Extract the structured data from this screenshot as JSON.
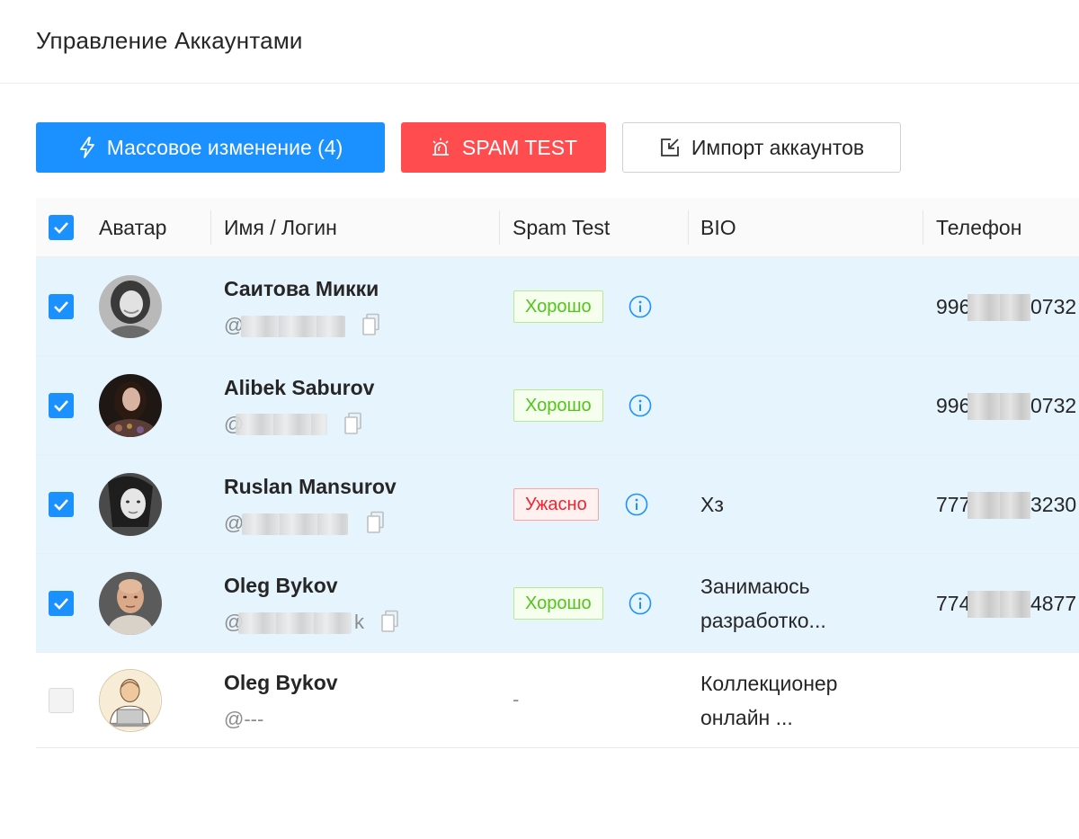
{
  "header": {
    "title": "Управление Аккаунтами"
  },
  "toolbar": {
    "mass_edit_label": "Массовое изменение (4)",
    "spam_test_label": "SPAM TEST",
    "import_label": "Импорт аккаунтов",
    "colors": {
      "primary": "#1b90ff",
      "danger": "#ff4d4f"
    }
  },
  "table": {
    "columns": {
      "avatar": "Аватар",
      "name_login": "Имя / Логин",
      "spam_test": "Spam Test",
      "bio": "BIO",
      "phone": "Телефон"
    },
    "rows": [
      {
        "checked": true,
        "name": "Саитова Микки",
        "login_prefix": "@",
        "login_suffix": "",
        "status": "Хорошо",
        "status_kind": "good",
        "bio_line1": "",
        "bio_line2": "",
        "phone_start": "996",
        "phone_end": "0732"
      },
      {
        "checked": true,
        "name": "Alibek Saburov",
        "login_prefix": "@",
        "login_suffix": "",
        "status": "Хорошо",
        "status_kind": "good",
        "bio_line1": "",
        "bio_line2": "",
        "phone_start": "996",
        "phone_end": "0732"
      },
      {
        "checked": true,
        "name": "Ruslan Mansurov",
        "login_prefix": "@",
        "login_suffix": "",
        "status": "Ужасно",
        "status_kind": "bad",
        "bio_line1": "Хз",
        "bio_line2": "",
        "phone_start": "777",
        "phone_end": "3230"
      },
      {
        "checked": true,
        "name": "Oleg Bykov",
        "login_prefix": "@",
        "login_suffix": "k",
        "status": "Хорошо",
        "status_kind": "good",
        "bio_line1": "Занимаюсь",
        "bio_line2": "разработко...",
        "phone_start": "774",
        "phone_end": "4877"
      },
      {
        "checked": false,
        "name": "Oleg Bykov",
        "login_prefix": "@---",
        "login_suffix": "",
        "status": "-",
        "status_kind": "none",
        "bio_line1": "Коллекционер",
        "bio_line2": "онлайн ...",
        "phone_start": "",
        "phone_end": ""
      }
    ]
  },
  "icons": {
    "mass_edit": "lightning-icon",
    "spam_test": "alarm-siren-icon",
    "import": "import-arrow-icon",
    "copy": "copy-icon",
    "info": "info-circle-icon",
    "check": "check-icon"
  }
}
